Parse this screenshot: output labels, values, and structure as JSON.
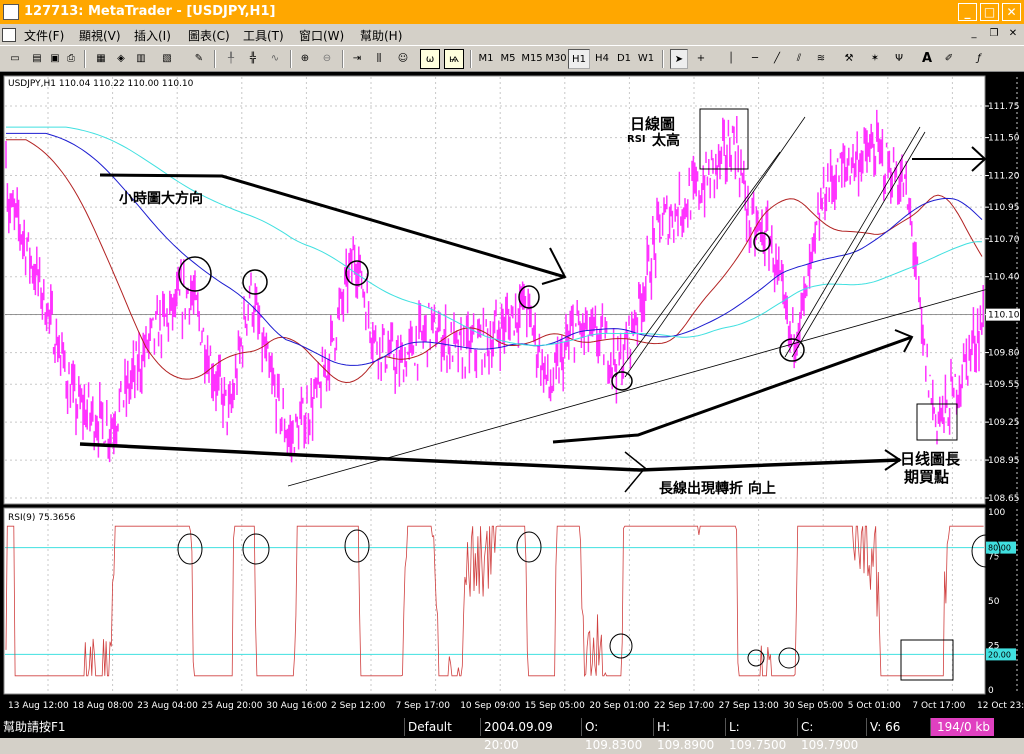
{
  "window": {
    "title": "127713: MetaTrader - [USDJPY,H1]",
    "buttons": {
      "minimize": "_",
      "maximize": "□",
      "close": "✕"
    }
  },
  "menu": [
    "文件(F)",
    "顯視(V)",
    "插入(I)",
    "圖表(C)",
    "工具(T)",
    "窗口(W)",
    "幫助(H)"
  ],
  "toolbar": {
    "timeframes": [
      "M1",
      "M5",
      "M15",
      "M30",
      "H1",
      "H4",
      "D1",
      "W1"
    ],
    "active_timeframe": "H1"
  },
  "price_chart": {
    "header": "USDJPY,H1  110.04 110.22 110.00 110.10",
    "current_price": "110.10",
    "price_ticks": [
      "111.75",
      "111.50",
      "111.20",
      "110.95",
      "110.70",
      "110.40",
      "110.10",
      "109.80",
      "109.55",
      "109.25",
      "108.95",
      "108.65"
    ],
    "annotations": {
      "trend_hourly": "小時圖大方向",
      "daily_rsi_line1": "日線圖",
      "daily_rsi_rsi": "RSI",
      "daily_rsi_high": "太高",
      "long_turn": "長線出現轉折 向上",
      "daily_buy_line1": "日线圖長",
      "daily_buy_line2": "期買點"
    }
  },
  "rsi_panel": {
    "header": "RSI(9)  75.3656",
    "ticks": [
      "100",
      "75",
      "50",
      "25",
      "0"
    ],
    "badge_high": "80.00",
    "badge_low": "20.00"
  },
  "x_axis": [
    "13 Aug 12:00",
    "18 Aug 08:00",
    "23 Aug 04:00",
    "25 Aug 20:00",
    "30 Aug 16:00",
    "2 Sep 12:00",
    "7 Sep 17:00",
    "10 Sep 09:00",
    "15 Sep 05:00",
    "20 Sep 01:00",
    "22 Sep 17:00",
    "27 Sep 13:00",
    "30 Sep 05:00",
    "5 Oct 01:00",
    "7 Oct 17:00",
    "12 Oct 23:00"
  ],
  "status": {
    "help": "幫助請按F1",
    "profile": "Default",
    "datetime": "2004.09.09 20:00",
    "open": "O: 109.8300",
    "high": "H: 109.8900",
    "low": "L: 109.7500",
    "close": "C: 109.7900",
    "volume": "V: 66",
    "traffic": "194/0 kb"
  },
  "colors": {
    "price": "#ff33ff",
    "ma_fast": "#b22222",
    "ma_mid": "#1c1cd0",
    "ma_slow": "#40e0e0",
    "rsi_line": "#d04040",
    "rsi_level": "#40e0e0",
    "grid": "#c8c8c8",
    "title_bar": "#ffa700"
  }
}
